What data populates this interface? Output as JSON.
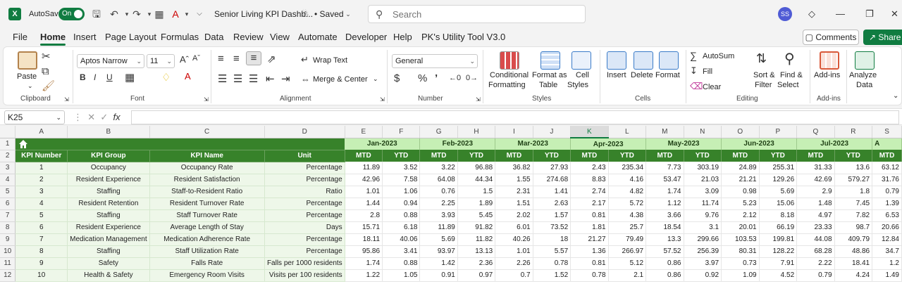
{
  "titlebar": {
    "autosave_label": "AutoSave",
    "autosave_state": "On",
    "doc_title": "Senior Living KPI Dashb...",
    "saved_status": "• Saved",
    "search_placeholder": "Search",
    "avatar_initials": "SS"
  },
  "menu": {
    "tabs": [
      "File",
      "Home",
      "Insert",
      "Page Layout",
      "Formulas",
      "Data",
      "Review",
      "View",
      "Automate",
      "Developer",
      "Help",
      "PK's Utility Tool V3.0"
    ],
    "active": "Home",
    "comments_label": "Comments",
    "share_label": "Share"
  },
  "ribbon": {
    "clipboard": {
      "paste": "Paste",
      "label": "Clipboard"
    },
    "font": {
      "family": "Aptos Narrow",
      "size": "11",
      "label": "Font"
    },
    "alignment": {
      "wrap": "Wrap Text",
      "merge": "Merge & Center",
      "label": "Alignment"
    },
    "number": {
      "format": "General",
      "label": "Number"
    },
    "styles": {
      "cond_l1": "Conditional",
      "cond_l2": "Formatting",
      "table_l1": "Format as",
      "table_l2": "Table",
      "cell_l1": "Cell",
      "cell_l2": "Styles",
      "label": "Styles"
    },
    "cells": {
      "insert": "Insert",
      "delete": "Delete",
      "format": "Format",
      "label": "Cells"
    },
    "editing": {
      "autosum": "AutoSum",
      "fill": "Fill",
      "clear": "Clear",
      "sort_l1": "Sort &",
      "sort_l2": "Filter",
      "find_l1": "Find &",
      "find_l2": "Select",
      "label": "Editing"
    },
    "addins": {
      "addins": "Add-ins",
      "label": "Add-ins",
      "analyze_l1": "Analyze",
      "analyze_l2": "Data"
    }
  },
  "formula_bar": {
    "name_box": "K25",
    "fx": "fx",
    "content": ""
  },
  "sheet": {
    "col_letters": [
      "A",
      "B",
      "C",
      "D",
      "E",
      "F",
      "G",
      "H",
      "I",
      "J",
      "K",
      "L",
      "M",
      "N",
      "O",
      "P",
      "Q",
      "R",
      "S"
    ],
    "selected_col": "K",
    "row_numbers": [
      "1",
      "2",
      "3",
      "4",
      "5",
      "6",
      "7",
      "8",
      "9",
      "10",
      "11",
      "12"
    ],
    "headers": [
      "KPI Number",
      "KPI Group",
      "KPI Name",
      "Unit"
    ],
    "months": [
      "Jan-2023",
      "Feb-2023",
      "Mar-2023",
      "Apr-2023",
      "May-2023",
      "Jun-2023",
      "Jul-2023",
      "A"
    ],
    "mtd": "MTD",
    "ytd": "YTD",
    "rows": [
      {
        "num": "1",
        "group": "Occupancy",
        "name": "Occupancy Rate",
        "unit": "Percentage",
        "vals": [
          "11.89",
          "3.52",
          "3.22",
          "96.88",
          "36.82",
          "27.93",
          "2.43",
          "235.34",
          "7.73",
          "303.19",
          "24.89",
          "255.31",
          "31.33",
          "13.6",
          "63.12"
        ]
      },
      {
        "num": "2",
        "group": "Resident Experience",
        "name": "Resident Satisfaction",
        "unit": "Percentage",
        "vals": [
          "42.96",
          "7.58",
          "64.08",
          "44.34",
          "1.55",
          "274.68",
          "8.83",
          "4.16",
          "53.47",
          "21.03",
          "21.21",
          "129.26",
          "42.69",
          "579.27",
          "31.76"
        ]
      },
      {
        "num": "3",
        "group": "Staffing",
        "name": "Staff-to-Resident Ratio",
        "unit": "Ratio",
        "vals": [
          "1.01",
          "1.06",
          "0.76",
          "1.5",
          "2.31",
          "1.41",
          "2.74",
          "4.82",
          "1.74",
          "3.09",
          "0.98",
          "5.69",
          "2.9",
          "1.8",
          "0.79"
        ]
      },
      {
        "num": "4",
        "group": "Resident Retention",
        "name": "Resident Turnover Rate",
        "unit": "Percentage",
        "vals": [
          "1.44",
          "0.94",
          "2.25",
          "1.89",
          "1.51",
          "2.63",
          "2.17",
          "5.72",
          "1.12",
          "11.74",
          "5.23",
          "15.06",
          "1.48",
          "7.45",
          "1.39"
        ]
      },
      {
        "num": "5",
        "group": "Staffing",
        "name": "Staff Turnover Rate",
        "unit": "Percentage",
        "vals": [
          "2.8",
          "0.88",
          "3.93",
          "5.45",
          "2.02",
          "1.57",
          "0.81",
          "4.38",
          "3.66",
          "9.76",
          "2.12",
          "8.18",
          "4.97",
          "7.82",
          "6.53"
        ]
      },
      {
        "num": "6",
        "group": "Resident Experience",
        "name": "Average Length of Stay",
        "unit": "Days",
        "vals": [
          "15.71",
          "6.18",
          "11.89",
          "91.82",
          "6.01",
          "73.52",
          "1.81",
          "25.7",
          "18.54",
          "3.1",
          "20.01",
          "66.19",
          "23.33",
          "98.7",
          "20.66"
        ]
      },
      {
        "num": "7",
        "group": "Medication Management",
        "name": "Medication Adherence Rate",
        "unit": "Percentage",
        "vals": [
          "18.11",
          "40.06",
          "5.69",
          "11.82",
          "40.26",
          "18",
          "21.27",
          "79.49",
          "13.3",
          "299.66",
          "103.53",
          "199.81",
          "44.08",
          "409.79",
          "12.84"
        ]
      },
      {
        "num": "8",
        "group": "Staffing",
        "name": "Staff Utilization Rate",
        "unit": "Percentage",
        "vals": [
          "95.86",
          "3.41",
          "93.97",
          "13.13",
          "1.01",
          "5.57",
          "1.36",
          "266.97",
          "57.52",
          "256.39",
          "80.31",
          "128.22",
          "68.28",
          "48.86",
          "34.7"
        ]
      },
      {
        "num": "9",
        "group": "Safety",
        "name": "Falls Rate",
        "unit": "Falls per 1000 residents",
        "vals": [
          "1.74",
          "0.88",
          "1.42",
          "2.36",
          "2.26",
          "0.78",
          "0.81",
          "5.12",
          "0.86",
          "3.97",
          "0.73",
          "7.91",
          "2.22",
          "18.41",
          "1.2"
        ]
      },
      {
        "num": "10",
        "group": "Health & Safety",
        "name": "Emergency Room Visits",
        "unit": "Visits per 100 residents",
        "vals": [
          "1.22",
          "1.05",
          "0.91",
          "0.97",
          "0.7",
          "1.52",
          "0.78",
          "2.1",
          "0.86",
          "0.92",
          "1.09",
          "4.52",
          "0.79",
          "4.24",
          "1.49"
        ]
      }
    ]
  },
  "colors": {
    "excel_green": "#107c41",
    "header_dark": "#37822a",
    "month_band": "#c6efb5",
    "row_band": "#eef7e9"
  }
}
